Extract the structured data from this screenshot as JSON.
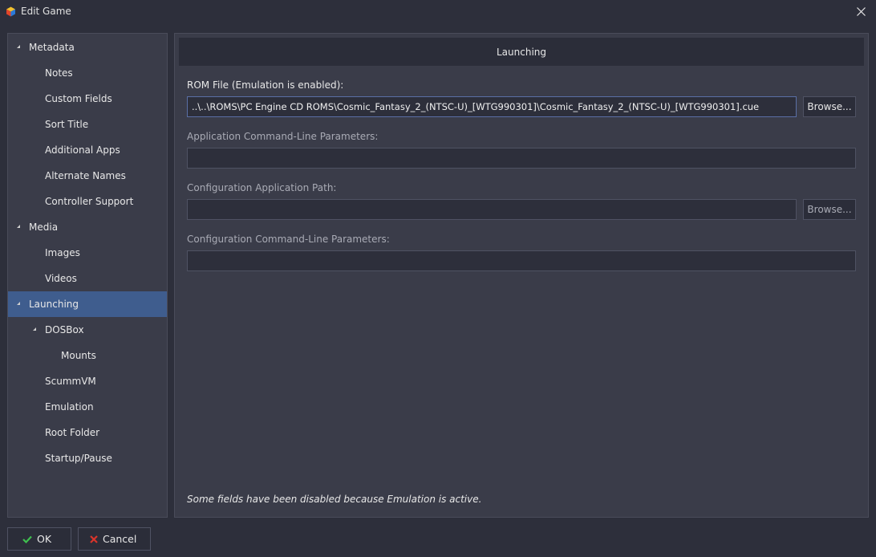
{
  "window": {
    "title": "Edit Game"
  },
  "sidebar": {
    "items": [
      {
        "label": "Metadata",
        "expanded": true
      },
      {
        "label": "Notes"
      },
      {
        "label": "Custom Fields"
      },
      {
        "label": "Sort Title"
      },
      {
        "label": "Additional Apps"
      },
      {
        "label": "Alternate Names"
      },
      {
        "label": "Controller Support"
      },
      {
        "label": "Media",
        "expanded": true
      },
      {
        "label": "Images"
      },
      {
        "label": "Videos"
      },
      {
        "label": "Launching",
        "expanded": true,
        "selected": true
      },
      {
        "label": "DOSBox",
        "expanded": true
      },
      {
        "label": "Mounts"
      },
      {
        "label": "ScummVM"
      },
      {
        "label": "Emulation"
      },
      {
        "label": "Root Folder"
      },
      {
        "label": "Startup/Pause"
      }
    ]
  },
  "main": {
    "header": "Launching",
    "rom_file": {
      "label": "ROM File (Emulation is enabled):",
      "value": "..\\..\\ROMS\\PC Engine CD ROMS\\Cosmic_Fantasy_2_(NTSC-U)_[WTG990301]\\Cosmic_Fantasy_2_(NTSC-U)_[WTG990301].cue",
      "browse": "Browse..."
    },
    "app_params": {
      "label": "Application Command-Line Parameters:",
      "value": ""
    },
    "config_path": {
      "label": "Configuration Application Path:",
      "value": "",
      "browse": "Browse..."
    },
    "config_params": {
      "label": "Configuration Command-Line Parameters:",
      "value": ""
    },
    "note": "Some fields have been disabled because Emulation is active."
  },
  "footer": {
    "ok_label": "OK",
    "cancel_label": "Cancel"
  },
  "colors": {
    "background": "#2d2f3b",
    "panel": "#3a3c49",
    "selected": "#3f5d8e",
    "ok_check": "#3fbf4f",
    "cancel_x": "#d9342b"
  }
}
